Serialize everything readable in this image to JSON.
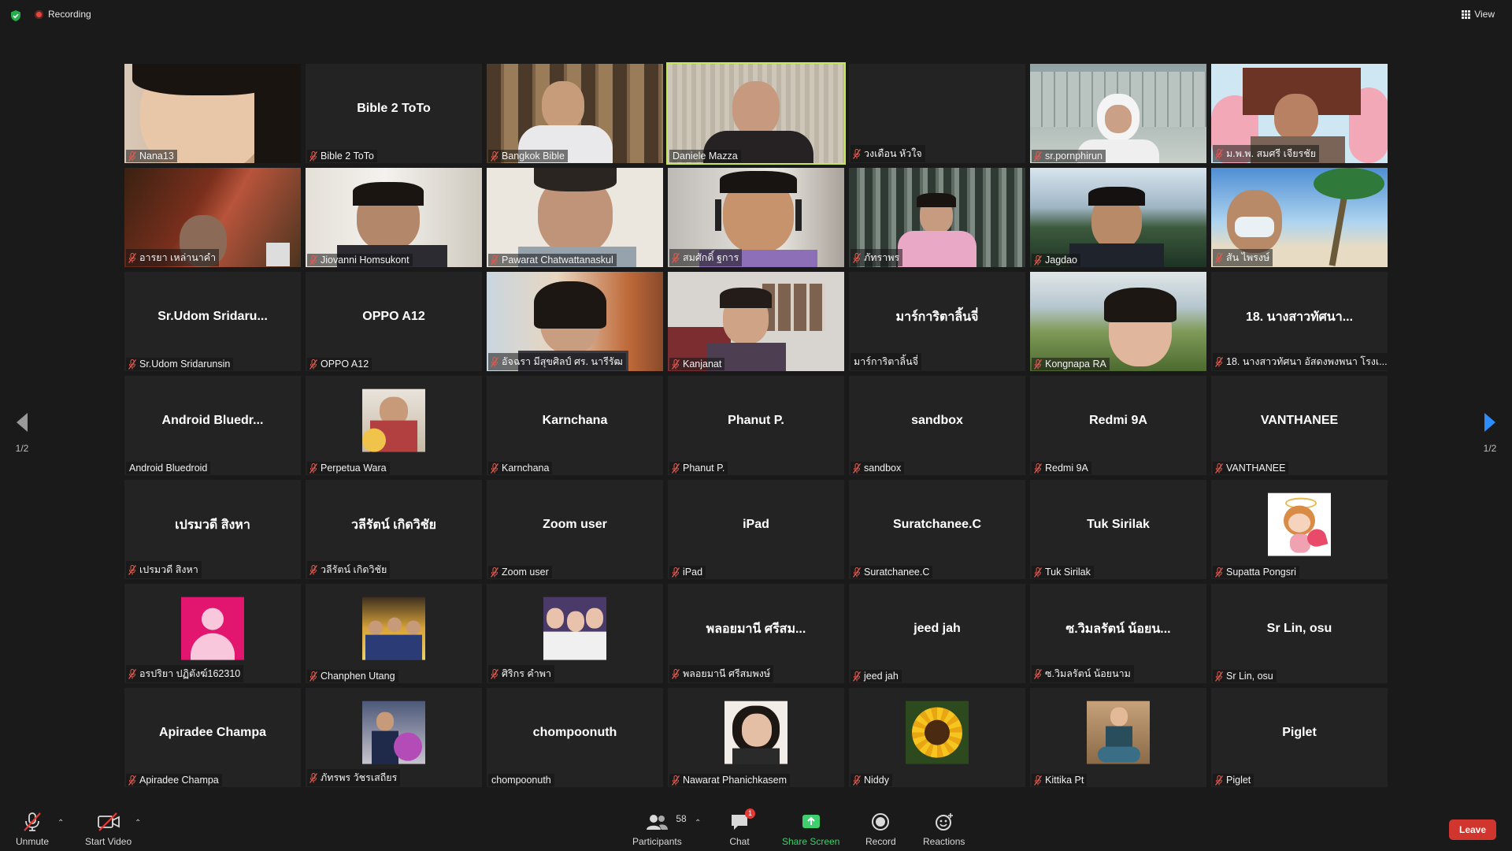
{
  "top_bar": {
    "recording_label": "Recording",
    "view_label": "View"
  },
  "colors": {
    "background": "#1a1a1a",
    "tile": "#232323",
    "active_speaker": "#c7e75a",
    "muted_icon": "#e05a4f",
    "share_screen": "#3fcf6f",
    "leave": "#d0362e"
  },
  "pagination": {
    "left_page": "1/2",
    "right_page": "1/2"
  },
  "participants": [
    {
      "name": "Nana13",
      "muted": true,
      "video": "girl-face"
    },
    {
      "name": "Bible 2 ToTo",
      "muted": true,
      "title": "Bible 2 ToTo"
    },
    {
      "name": "Bangkok Bible",
      "muted": true,
      "video": "man-bookshelf"
    },
    {
      "name": "Daniele Mazza",
      "muted": false,
      "video": "priest",
      "active": true
    },
    {
      "name": "วงเดือน หัวใจ",
      "muted": true,
      "video": "dark"
    },
    {
      "name": "sr.pornphirun",
      "muted": true,
      "video": "nun-room"
    },
    {
      "name": "ม.พ.พ. สมศรี เจียรชัย",
      "muted": true,
      "video": "painting-woman"
    },
    {
      "name": "อารยา เหล่านาคำ",
      "muted": true,
      "video": "painting-red"
    },
    {
      "name": "Jiovanni Homsukont",
      "muted": true,
      "video": "man-glasses"
    },
    {
      "name": "Pawarat Chatwattanaskul",
      "muted": true,
      "video": "man-thinking"
    },
    {
      "name": "สมศักดิ์ ฐการ",
      "muted": true,
      "video": "man-headset"
    },
    {
      "name": "ภัทราพร",
      "muted": true,
      "video": "girl-curtain"
    },
    {
      "name": "Jagdao",
      "muted": true,
      "video": "man-mountain"
    },
    {
      "name": "สัน ไพรงษ์",
      "muted": true,
      "video": "man-beach"
    },
    {
      "name": "Sr.Udom Sridarunsin",
      "muted": true,
      "title": "Sr.Udom  Sridaru..."
    },
    {
      "name": "OPPO A12",
      "muted": true,
      "title": "OPPO A12"
    },
    {
      "name": "อัจฉรา มีสุขศิลป์ ศร. นารีรัฒ",
      "muted": true,
      "video": "woman-glasses"
    },
    {
      "name": "Kanjanat",
      "muted": true,
      "video": "woman-pink"
    },
    {
      "name": "มาร์การิตาลิ้นจี่",
      "muted": false,
      "title": "มาร์การิตาลิ้นจี่"
    },
    {
      "name": "Kongnapa RA",
      "muted": true,
      "video": "woman-field"
    },
    {
      "name": "18. นางสาวทัศนา อัสดงพงพนา โรงเ...",
      "muted": true,
      "title": "18. นางสาวทัศนา..."
    },
    {
      "name": "Android Bluedroid",
      "muted": false,
      "title": "Android  Bluedr..."
    },
    {
      "name": "Perpetua Wara",
      "muted": true,
      "avatar": "flowers-man"
    },
    {
      "name": "Karnchana",
      "muted": true,
      "title": "Karnchana"
    },
    {
      "name": "Phanut P.",
      "muted": true,
      "title": "Phanut P."
    },
    {
      "name": "sandbox",
      "muted": true,
      "title": "sandbox"
    },
    {
      "name": "Redmi 9A",
      "muted": true,
      "title": "Redmi 9A"
    },
    {
      "name": "VANTHANEE",
      "muted": true,
      "title": "VANTHANEE"
    },
    {
      "name": "เปรมวดี สิงหา",
      "muted": true,
      "title": "เปรมวดี สิงหา"
    },
    {
      "name": "วลีรัตน์ เกิดวิชัย",
      "muted": true,
      "title": "วลีรัตน์ เกิดวิชัย"
    },
    {
      "name": "Zoom user",
      "muted": true,
      "title": "Zoom user"
    },
    {
      "name": "iPad",
      "muted": true,
      "title": "iPad"
    },
    {
      "name": "Suratchanee.C",
      "muted": true,
      "title": "Suratchanee.C"
    },
    {
      "name": "Tuk Sirilak",
      "muted": true,
      "title": "Tuk Sirilak"
    },
    {
      "name": "Supatta Pongsri",
      "muted": true,
      "avatar": "cupid"
    },
    {
      "name": "อรปริยา ปฏิตังฆ์162310",
      "muted": true,
      "avatar": "default-user"
    },
    {
      "name": "Chanphen Utang",
      "muted": true,
      "avatar": "group-photo"
    },
    {
      "name": "ศิริกร คำพา",
      "muted": true,
      "avatar": "three-girls"
    },
    {
      "name": "พลอยมานี ศรีสมพงษ์",
      "muted": true,
      "title": "พลอยมานี ศรีสม..."
    },
    {
      "name": "jeed jah",
      "muted": true,
      "title": "jeed jah"
    },
    {
      "name": "ซ.วิมลรัตน์ น้อยนาม",
      "muted": true,
      "title": "ซ.วิมลรัตน์ น้อยน..."
    },
    {
      "name": "Sr Lin, osu",
      "muted": true,
      "title": "Sr Lin, osu"
    },
    {
      "name": "Apiradee Champa",
      "muted": true,
      "title": "Apiradee Champa"
    },
    {
      "name": "ภัทรพร วัชรเสถียร",
      "muted": true,
      "avatar": "woman-flowers"
    },
    {
      "name": "chompoonuth",
      "muted": false,
      "title": "chompoonuth"
    },
    {
      "name": "Nawarat Phanichkasem",
      "muted": true,
      "avatar": "woman-portrait"
    },
    {
      "name": "Niddy",
      "muted": true,
      "avatar": "sunflower"
    },
    {
      "name": "Kittika Pt",
      "muted": true,
      "avatar": "girl-sitting"
    },
    {
      "name": "Piglet",
      "muted": true,
      "title": "Piglet"
    }
  ],
  "toolbar": {
    "unmute_label": "Unmute",
    "start_video_label": "Start Video",
    "participants_label": "Participants",
    "participants_count": "58",
    "chat_label": "Chat",
    "chat_badge": "1",
    "share_screen_label": "Share Screen",
    "record_label": "Record",
    "reactions_label": "Reactions",
    "leave_label": "Leave"
  }
}
